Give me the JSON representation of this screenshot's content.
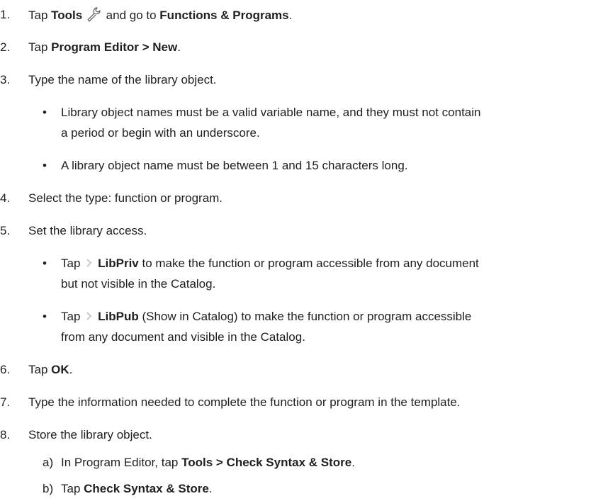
{
  "steps": [
    {
      "num": "1.",
      "pre": "Tap ",
      "bold1": "Tools",
      "icon": "wrench-icon",
      "mid": " and go to ",
      "bold2": "Functions & Programs",
      "post": "."
    },
    {
      "num": "2.",
      "pre": "Tap ",
      "bold1": "Program Editor > New",
      "post": "."
    },
    {
      "num": "3.",
      "text": "Type the name of the library object.",
      "bullets": [
        {
          "lines": [
            "Library object names must be a valid variable name, and they must not contain",
            "a period or begin with an underscore."
          ]
        },
        {
          "lines": [
            "A library object name must be between 1 and 15 characters long."
          ]
        }
      ]
    },
    {
      "num": "4.",
      "text": "Select the type: function or program."
    },
    {
      "num": "5.",
      "text": "Set the library access.",
      "bullets": [
        {
          "pre": "Tap ",
          "icon": "chevron-right-icon",
          "bold": "LibPriv",
          "post": " to make the function or program accessible from any document",
          "cont": "but not visible in the Catalog."
        },
        {
          "pre": "Tap ",
          "icon": "chevron-right-icon",
          "bold": "LibPub",
          "post": " (Show in Catalog) to make the function or program accessible",
          "cont": "from any document and visible in the Catalog."
        }
      ]
    },
    {
      "num": "6.",
      "pre": "Tap ",
      "bold1": "OK",
      "post": "."
    },
    {
      "num": "7.",
      "text": "Type the information needed to complete the function or program in the template."
    },
    {
      "num": "8.",
      "text": "Store the library object.",
      "substeps": [
        {
          "label": "a)",
          "pre": "In Program Editor, tap ",
          "bold": "Tools > Check Syntax & Store",
          "post": "."
        },
        {
          "label": "b)",
          "pre": "Tap ",
          "bold": "Check Syntax & Store",
          "post": "."
        }
      ]
    }
  ],
  "bullet_char": "•",
  "colors": {
    "text": "#1f1f1f",
    "chevron": "#c8c8c8",
    "icon_stroke": "#555555"
  }
}
